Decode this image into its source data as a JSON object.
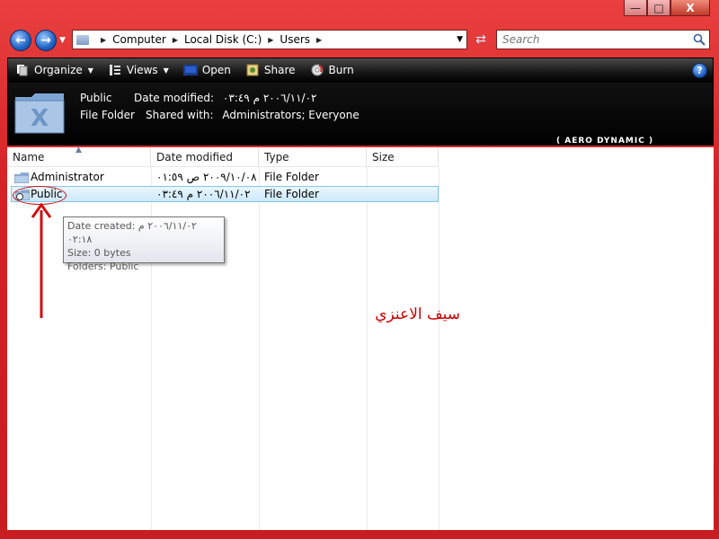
{
  "window": {
    "caption_buttons": {
      "minimize": "—",
      "maximize": "□",
      "close": "X"
    }
  },
  "address": {
    "path": [
      "Computer",
      "Local Disk (C:)",
      "Users"
    ],
    "search_placeholder": "Search"
  },
  "toolbar": {
    "organize_label": "Organize",
    "views_label": "Views",
    "open_label": "Open",
    "share_label": "Share",
    "burn_label": "Burn",
    "help_label": "?"
  },
  "details": {
    "name": "Public",
    "type": "File Folder",
    "date_modified_label": "Date modified:",
    "date_modified_value": "٢٠٠٦/١١/٠٢ م ٠٣:٤٩",
    "shared_label": "Shared with:",
    "shared_value": "Administrators; Everyone",
    "brand": "( AERO DYNAMIC )"
  },
  "columns": [
    "Name",
    "Date modified",
    "Type",
    "Size"
  ],
  "rows": [
    {
      "name": "Administrator",
      "date": "٢٠٠٩/١٠/٠٨ ص ٠١:٥٩",
      "type": "File Folder",
      "size": ""
    },
    {
      "name": "Public",
      "date": "٢٠٠٦/١١/٠٢ م ٠٣:٤٩",
      "type": "File Folder",
      "size": ""
    }
  ],
  "tooltip": {
    "line1": "Date created: ٢٠٠٦/١١/٠٢ م ٠٢:١٨",
    "line2": "Size: 0 bytes",
    "line3": "Folders: Public"
  },
  "annotation": {
    "text": "سيف الاعنزي"
  },
  "colors": {
    "frame": "#d42226",
    "toolbar": "#000000",
    "selection": "#cde9fb",
    "annotation": "#c80000"
  }
}
